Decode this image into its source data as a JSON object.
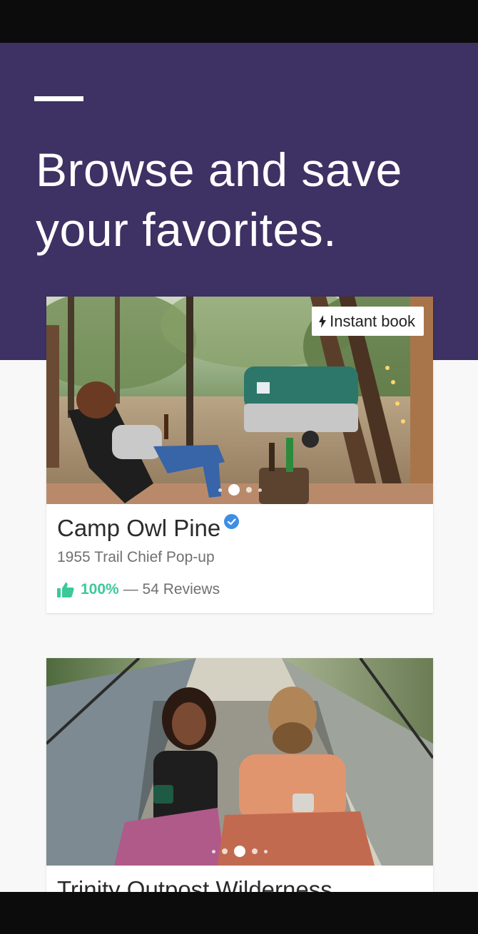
{
  "hero": {
    "title": "Browse and save your favorites."
  },
  "listings": [
    {
      "name": "Camp Owl Pine",
      "subtitle": "1955 Trail Chief Pop-up",
      "badge": "Instant book",
      "badge_icon": "bolt-icon",
      "verified_icon": "verified-check-icon",
      "rating_icon": "thumbs-up-icon",
      "rating_percent": "100%",
      "reviews_text": "— 54 Reviews",
      "photo_count": 5,
      "active_photo": 2
    },
    {
      "name": "Trinity Outpost Wilderness",
      "photo_count": 5,
      "active_photo": 3
    }
  ],
  "colors": {
    "hero_bg": "#3e3163",
    "accent_green": "#3cc99a",
    "verified_blue": "#3d8fe6",
    "system_bars": "#0c0c0c"
  }
}
